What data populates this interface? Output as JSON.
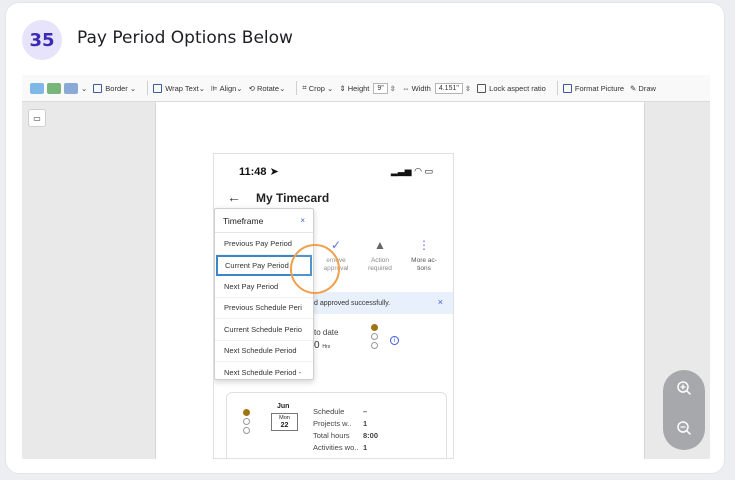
{
  "step": {
    "number": "35",
    "title": "Pay Period Options Below"
  },
  "ribbon": {
    "border": "Border",
    "wrap_text": "Wrap Text",
    "align": "Align",
    "rotate": "Rotate",
    "crop": "Crop",
    "height_label": "Height",
    "height_value": "9\"",
    "width_label": "Width",
    "width_value": "4.151\"",
    "lock_aspect": "Lock aspect ratio",
    "format_picture": "Format Picture",
    "draw": "Draw"
  },
  "phone": {
    "time": "11:48",
    "title": "My Timecard",
    "dropdown": {
      "title": "Timeframe",
      "close": "×",
      "items": [
        "Previous Pay Period",
        "Current Pay Period",
        "Next Pay Period",
        "Previous Schedule Peri",
        "Current Schedule Perio",
        "Next Schedule Period",
        "Next Schedule Period -"
      ],
      "selected_index": 1
    },
    "actions": [
      {
        "icon": "check-icon",
        "line1": "emove",
        "line2": "approval"
      },
      {
        "icon": "warning-icon",
        "line1": "Action",
        "line2": "required"
      },
      {
        "icon": "more-icon",
        "line1": "More ac-",
        "line2": "tions"
      }
    ],
    "toast": "d approved successfully.",
    "toast_close": "×",
    "to_date": "to date",
    "big_value": "0",
    "big_unit": "Hrs",
    "schedule": {
      "month": "Jun",
      "day_label": "Mon",
      "day": "22",
      "rows": [
        {
          "label": "Schedule",
          "value": "–"
        },
        {
          "label": "Projects w..",
          "value": "1"
        },
        {
          "label": "Total hours",
          "value": "8:00"
        },
        {
          "label": "Activities wo..",
          "value": "1"
        }
      ]
    }
  },
  "colors": {
    "highlight": "#f0a04b",
    "accent": "#3b5bdb",
    "badge_bg": "#e6e3fb",
    "badge_fg": "#3b2bb5"
  }
}
